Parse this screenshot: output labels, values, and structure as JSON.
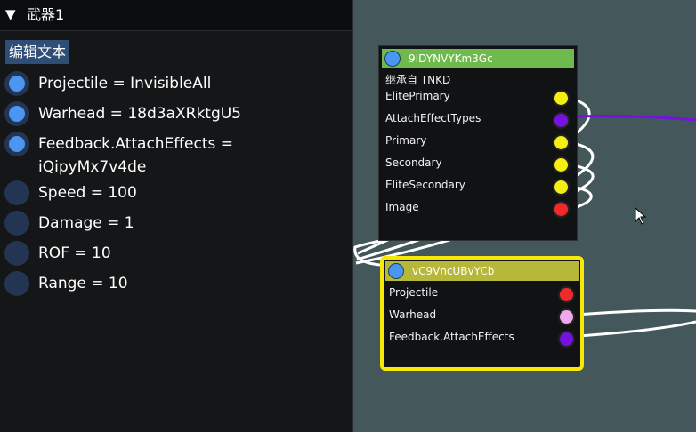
{
  "panel": {
    "collapse_icon": "triangle-down-icon",
    "title": "武器1",
    "edit_text": "编辑文本",
    "properties": [
      {
        "text": "Projectile = InvisibleAll",
        "set": true
      },
      {
        "text": "Warhead = 18d3aXRktgU5",
        "set": true
      },
      {
        "text": "Feedback.AttachEffects = iQipyMx7v4de",
        "set": true
      },
      {
        "text": "Speed = 100",
        "set": false
      },
      {
        "text": "Damage = 1",
        "set": false
      },
      {
        "text": "ROF = 10",
        "set": false
      },
      {
        "text": "Range = 10",
        "set": false
      }
    ]
  },
  "graph": {
    "background_color": "#44575a",
    "nodes": [
      {
        "title": "9IDYNVYKm3Gc",
        "header_color": "#6fba4d",
        "inherits": "继承自 TNKD",
        "pins": [
          {
            "label": "ElitePrimary",
            "color": "#f5ee12"
          },
          {
            "label": "AttachEffectTypes",
            "color": "#7512e0"
          },
          {
            "label": "Primary",
            "color": "#f5ee12"
          },
          {
            "label": "Secondary",
            "color": "#f5ee12"
          },
          {
            "label": "EliteSecondary",
            "color": "#f5ee12"
          },
          {
            "label": "Image",
            "color": "#f02a2a"
          }
        ]
      },
      {
        "title": "vC9VncUBvYCb",
        "header_color": "#b7b73a",
        "selected": true,
        "outline_color": "#f7e806",
        "pins": [
          {
            "label": "Projectile",
            "color": "#f02a2a"
          },
          {
            "label": "Warhead",
            "color": "#f0a8ea"
          },
          {
            "label": "Feedback.AttachEffects",
            "color": "#7512e0"
          }
        ]
      }
    ]
  }
}
